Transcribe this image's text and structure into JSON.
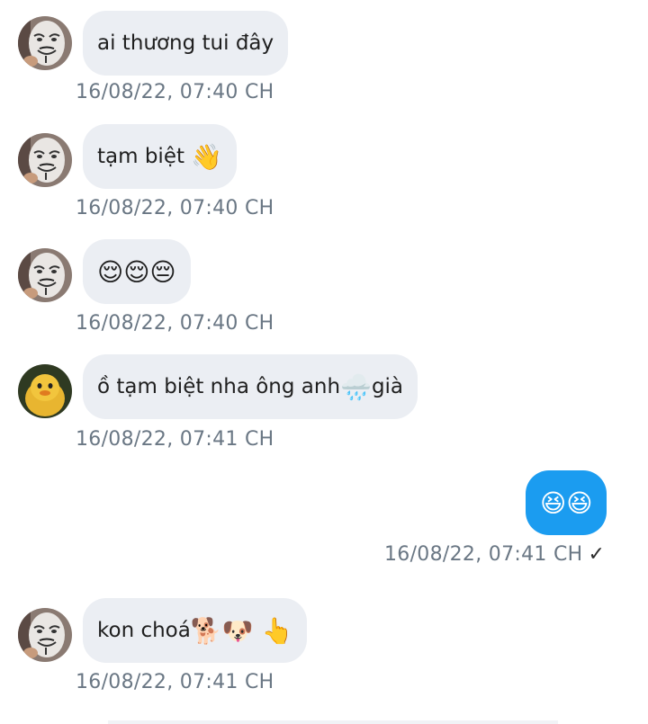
{
  "messages": [
    {
      "direction": "incoming",
      "sender_avatar": "guy-fawkes-mask-avatar",
      "text": "ai thương tui đây",
      "emoji": "",
      "time": "16/08/22,  07:40 CH"
    },
    {
      "direction": "incoming",
      "sender_avatar": "guy-fawkes-mask-avatar",
      "text": "tạm biệt ",
      "emoji": "👋",
      "time": "16/08/22,  07:40 CH"
    },
    {
      "direction": "incoming",
      "sender_avatar": "guy-fawkes-mask-avatar",
      "text": "",
      "emoji": "😌😌😔",
      "time": "16/08/22,  07:40 CH"
    },
    {
      "direction": "incoming",
      "sender_avatar": "yellow-duck-avatar",
      "text": "ồ tạm biệt nha ông anh",
      "emoji": "🌧️",
      "text_after": "già",
      "time": "16/08/22,  07:41 CH"
    },
    {
      "direction": "outgoing",
      "text": "",
      "emoji": "😆😆",
      "time": "16/08/22,  07:41 CH",
      "status_icon": "✓"
    },
    {
      "direction": "incoming",
      "sender_avatar": "guy-fawkes-mask-avatar",
      "text": "kon choá",
      "emoji": "🐕🐶 👆",
      "time": "16/08/22,  07:41 CH"
    }
  ],
  "colors": {
    "incoming_bubble": "#ebeef3",
    "outgoing_bubble": "#1b9cf0",
    "timestamp": "#6a7784"
  }
}
